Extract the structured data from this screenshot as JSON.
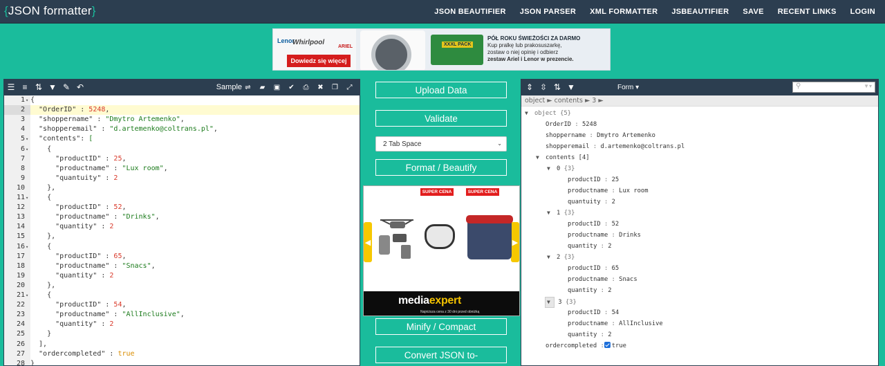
{
  "nav": {
    "logo_brace_open": "{",
    "logo_text": "JSON formatter",
    "logo_brace_close": "}",
    "links": [
      "JSON BEAUTIFIER",
      "JSON PARSER",
      "XML FORMATTER",
      "JSBEAUTIFIER",
      "SAVE",
      "RECENT LINKS",
      "LOGIN"
    ]
  },
  "ad_top": {
    "brand1": "Lenor",
    "brand2": "Whirlpool",
    "brand3": "ARIEL",
    "cta": "Dowiedz się więcej",
    "pack": "XXXL PACK",
    "headline": "PÓŁ ROKU ŚWIEŻOŚCI ZA DARMO",
    "body1": "Kup pralkę lub prakosuszarkę,",
    "body2": "zostaw o niej opinię i odbierz",
    "body3": "zestaw Ariel i Lenor w prezencie."
  },
  "left_toolbar": {
    "sample_label": "Sample"
  },
  "editor": {
    "lines": [
      {
        "no": "1",
        "fold": true,
        "text": "{"
      },
      {
        "no": "2",
        "fold": false,
        "text": "  \"OrderID\" : 5248,",
        "active": true
      },
      {
        "no": "3",
        "fold": false,
        "text": "  \"shoppername\" : \"Dmytro Artemenko\","
      },
      {
        "no": "4",
        "fold": false,
        "text": "  \"shopperemail\" : \"d.artemenko@coltrans.pl\","
      },
      {
        "no": "5",
        "fold": true,
        "text": "  \"contents\": ["
      },
      {
        "no": "6",
        "fold": true,
        "text": "    {"
      },
      {
        "no": "7",
        "fold": false,
        "text": "      \"productID\" : 25,"
      },
      {
        "no": "8",
        "fold": false,
        "text": "      \"productname\" : \"Lux room\","
      },
      {
        "no": "9",
        "fold": false,
        "text": "      \"quantuity\" : 2"
      },
      {
        "no": "10",
        "fold": false,
        "text": "    },"
      },
      {
        "no": "11",
        "fold": true,
        "text": "    {"
      },
      {
        "no": "12",
        "fold": false,
        "text": "      \"productID\" : 52,"
      },
      {
        "no": "13",
        "fold": false,
        "text": "      \"productname\" : \"Drinks\","
      },
      {
        "no": "14",
        "fold": false,
        "text": "      \"quantity\" : 2"
      },
      {
        "no": "15",
        "fold": false,
        "text": "    },"
      },
      {
        "no": "16",
        "fold": true,
        "text": "    {"
      },
      {
        "no": "17",
        "fold": false,
        "text": "      \"productID\" : 65,"
      },
      {
        "no": "18",
        "fold": false,
        "text": "      \"productname\" : \"Snacs\","
      },
      {
        "no": "19",
        "fold": false,
        "text": "      \"quantity\" : 2"
      },
      {
        "no": "20",
        "fold": false,
        "text": "    },"
      },
      {
        "no": "21",
        "fold": true,
        "text": "    {"
      },
      {
        "no": "22",
        "fold": false,
        "text": "      \"productID\" : 54,"
      },
      {
        "no": "23",
        "fold": false,
        "text": "      \"productname\" : \"AllInclusive\","
      },
      {
        "no": "24",
        "fold": false,
        "text": "      \"quantity\" : 2"
      },
      {
        "no": "25",
        "fold": false,
        "text": "    }"
      },
      {
        "no": "26",
        "fold": false,
        "text": "  ],"
      },
      {
        "no": "27",
        "fold": false,
        "text": "  \"ordercompleted\" : true"
      },
      {
        "no": "28",
        "fold": false,
        "text": "}"
      }
    ]
  },
  "middle": {
    "upload": "Upload Data",
    "validate": "Validate",
    "tab_space": "2 Tab Space",
    "format": "Format / Beautify",
    "minify": "Minify / Compact",
    "convert": "Convert JSON to-"
  },
  "ad_mid": {
    "badge1": "SUPER CENA",
    "badge2": "SUPER CENA",
    "brand_a": "media",
    "brand_b": "expert",
    "fine": "Najniższa cena z 30 dni przed obniżką"
  },
  "right_toolbar": {
    "form_label": "Form ▾"
  },
  "breadcrumb": "object ► contents ► 3 ►",
  "tree": {
    "root": "object {5}",
    "order_key": "OrderID",
    "order_val": "5248",
    "shopper_key": "shoppername",
    "shopper_val": "Dmytro Artemenko",
    "email_key": "shopperemail",
    "email_val": "d.artemenko@coltrans.pl",
    "contents_label": "contents [4]",
    "items": [
      {
        "idx": "0",
        "count": "{3}",
        "k1": "productID",
        "v1": "25",
        "k2": "productname",
        "v2": "Lux room",
        "k3": "quantuity",
        "v3": "2"
      },
      {
        "idx": "1",
        "count": "{3}",
        "k1": "productID",
        "v1": "52",
        "k2": "productname",
        "v2": "Drinks",
        "k3": "quantity",
        "v3": "2"
      },
      {
        "idx": "2",
        "count": "{3}",
        "k1": "productID",
        "v1": "65",
        "k2": "productname",
        "v2": "Snacs",
        "k3": "quantity",
        "v3": "2"
      },
      {
        "idx": "3",
        "count": "{3}",
        "k1": "productID",
        "v1": "54",
        "k2": "productname",
        "v2": "AllInclusive",
        "k3": "quantity",
        "v3": "2"
      }
    ],
    "completed_key": "ordercompleted",
    "completed_val": "true"
  }
}
